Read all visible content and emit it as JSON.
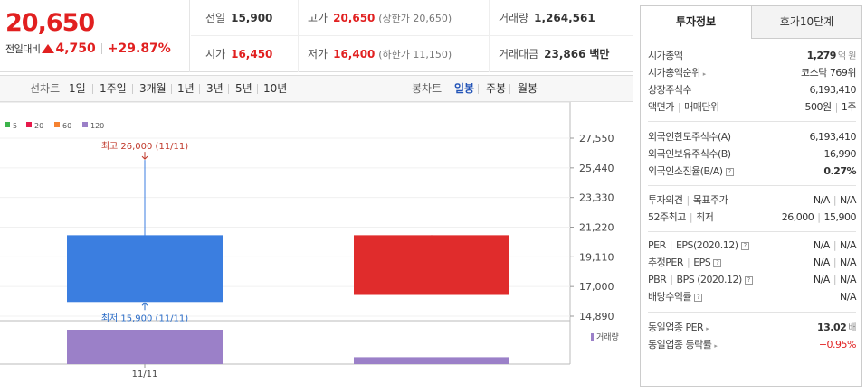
{
  "quote": {
    "price": "20,650",
    "change_label": "전일대비",
    "change_value": "4,750",
    "change_rate": "+29.87%"
  },
  "info": {
    "prev_close_label": "전일",
    "prev_close": "15,900",
    "high_label": "고가",
    "high": "20,650",
    "high_sub": "(상한가 20,650)",
    "volume_label": "거래량",
    "volume": "1,264,561",
    "open_label": "시가",
    "open": "16,450",
    "low_label": "저가",
    "low": "16,400",
    "low_sub": "(하한가 11,150)",
    "amount_label": "거래대금",
    "amount": "23,866",
    "amount_unit": "백만"
  },
  "period_tabs": {
    "lead": "선차트",
    "items": [
      "1일",
      "1주일",
      "3개월",
      "1년",
      "3년",
      "5년",
      "10년"
    ],
    "candle_lead": "봉차트",
    "candle_items": [
      "일봉",
      "주봉",
      "월봉"
    ],
    "active": "일봉"
  },
  "chart_data": {
    "type": "candlestick",
    "legend": [
      {
        "name": "5",
        "color": "#3cb44b"
      },
      {
        "name": "20",
        "color": "#e6194b"
      },
      {
        "name": "60",
        "color": "#f58231"
      },
      {
        "name": "120",
        "color": "#9b80c8"
      }
    ],
    "y_ticks": [
      27550,
      25440,
      23330,
      21220,
      19110,
      17000,
      14890
    ],
    "y_tick_labels": [
      "27,550",
      "25,440",
      "23,330",
      "21,220",
      "19,110",
      "17,000",
      "14,890"
    ],
    "ylim": [
      14890,
      27550
    ],
    "x_label": "11/11",
    "candles": [
      {
        "open": 20650,
        "close": 15900,
        "high": 26000,
        "low": 15900,
        "color": "#3b7ee0"
      },
      {
        "open": 16400,
        "close": 20650,
        "high": 20650,
        "low": 16400,
        "color": "#e02c2c"
      }
    ],
    "volume_label": "거래량",
    "volume_color": "#9b80c8",
    "volumes": [
      1.0,
      0.2
    ],
    "annotation_high": "최고 26,000 (11/11)",
    "annotation_low": "최저 15,900 (11/11)"
  },
  "side": {
    "tab1": "투자정보",
    "tab2": "호가10단계",
    "market_cap_label": "시가총액",
    "market_cap": "1,279",
    "market_cap_unit": "억 원",
    "cap_rank_label": "시가총액순위",
    "cap_rank": "코스닥 769위",
    "shares_label": "상장주식수",
    "shares": "6,193,410",
    "par_label": "액면가",
    "lot_label": "매매단위",
    "par": "500원",
    "lot": "1주",
    "foreign_limit_label": "외국인한도주식수(A)",
    "foreign_limit": "6,193,410",
    "foreign_hold_label": "외국인보유주식수(B)",
    "foreign_hold": "16,990",
    "foreign_rate_label": "외국인소진율(B/A)",
    "foreign_rate": "0.27%",
    "opinion_label": "투자의견",
    "target_label": "목표주가",
    "opinion": "N/A",
    "target": "N/A",
    "w52_high_label": "52주최고",
    "w52_low_label": "최저",
    "w52_high": "26,000",
    "w52_low": "15,900",
    "per_label": "PER",
    "eps_label": "EPS(2020.12)",
    "per": "N/A",
    "eps": "N/A",
    "est_per_label": "추정PER",
    "est_eps_label": "EPS",
    "est_per": "N/A",
    "est_eps": "N/A",
    "pbr_label": "PBR",
    "bps_label": "BPS (2020.12)",
    "pbr": "N/A",
    "bps": "N/A",
    "div_label": "배당수익률",
    "div": "N/A",
    "ind_per_label": "동일업종 PER",
    "ind_per": "13.02",
    "ind_per_unit": "배",
    "ind_rate_label": "동일업종 등락률",
    "ind_rate": "+0.95%",
    "q_mark": "?"
  }
}
